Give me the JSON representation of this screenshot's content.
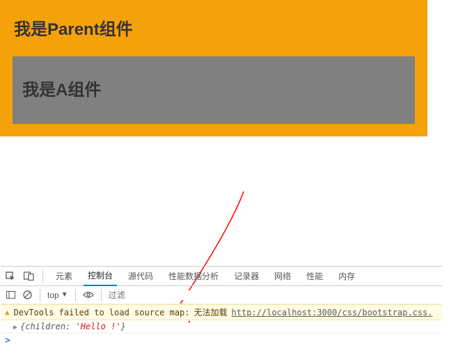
{
  "parent": {
    "title": "我是Parent组件",
    "child": {
      "title": "我是A组件"
    }
  },
  "devtools": {
    "tabs": {
      "elements": "元素",
      "console": "控制台",
      "sources": "源代码",
      "performance": "性能数据分析",
      "recorder": "记录器",
      "network": "网络",
      "perf2": "性能",
      "memory": "内存"
    },
    "toolbar": {
      "scope": "top",
      "filter_placeholder": "过滤"
    },
    "warning": {
      "prefix": "DevTools failed to load source map: ",
      "text": "无法加载",
      "link": "http://localhost:3000/css/bootstrap.css."
    },
    "log": {
      "open": "{",
      "key": "children: ",
      "value": "'Hello !'",
      "close": "}"
    },
    "prompt": ">"
  }
}
